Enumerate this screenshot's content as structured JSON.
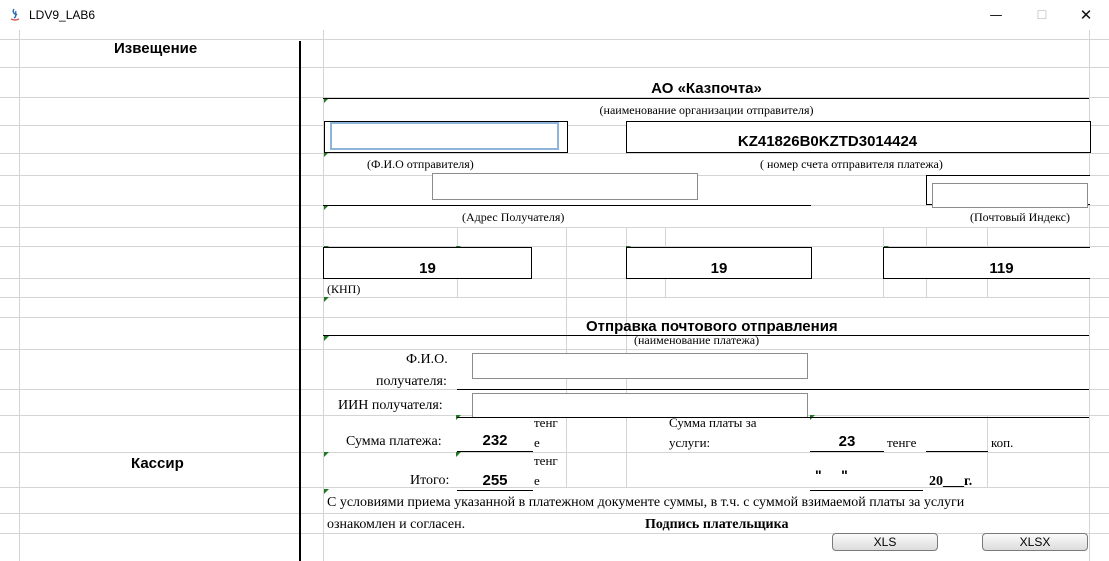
{
  "window": {
    "title": "LDV9_LAB6",
    "minimize": "—",
    "maximize": "☐",
    "close": "✕"
  },
  "left": {
    "notice": "Извещение",
    "cashier": "Кассир"
  },
  "form": {
    "org_name": "АО «Казпочта»",
    "org_caption": "(наименование организации отправителя)",
    "sender_name_value": "",
    "account_number": "KZ41826B0KZTD3014424",
    "sender_caption": "(Ф.И.О отправителя)",
    "account_caption": "( номер счета отправителя платежа)",
    "address_value": "",
    "postal_value": "",
    "address_caption": "(Адрес Получателя)",
    "postal_caption": "(Почтовый Индекс)",
    "knp1": "19",
    "knp2": "19",
    "knp3": "119",
    "knp_caption": "(КНП)",
    "payment_name": "Отправка почтового отправления",
    "payment_caption": "(наименование платежа)",
    "recipient_label_1": "Ф.И.О.",
    "recipient_label_2": "получателя:",
    "recipient_value": "",
    "iin_label": "ИИН получателя:",
    "iin_value": "",
    "amount_label": "Сумма платежа:",
    "amount_value": "232",
    "tenge_part1": "тенг",
    "tenge_part2": "е",
    "fee_label_1": "Сумма платы за",
    "fee_label_2": "услуги:",
    "fee_value": "23",
    "fee_tenge": "тенге",
    "fee_kop": "коп.",
    "total_label": "Итого:",
    "total_value": "255",
    "quote_marks": "\"     \"",
    "year": "20___г.",
    "terms_line1": "С условиями приема указанной в платежном документе суммы, в т.ч. с суммой взимаемой платы за услуги",
    "terms_line2": "ознакомлен и согласен.",
    "signature": "Подпись плательщика"
  },
  "buttons": {
    "xls": "XLS",
    "xlsx": "XLSX"
  }
}
